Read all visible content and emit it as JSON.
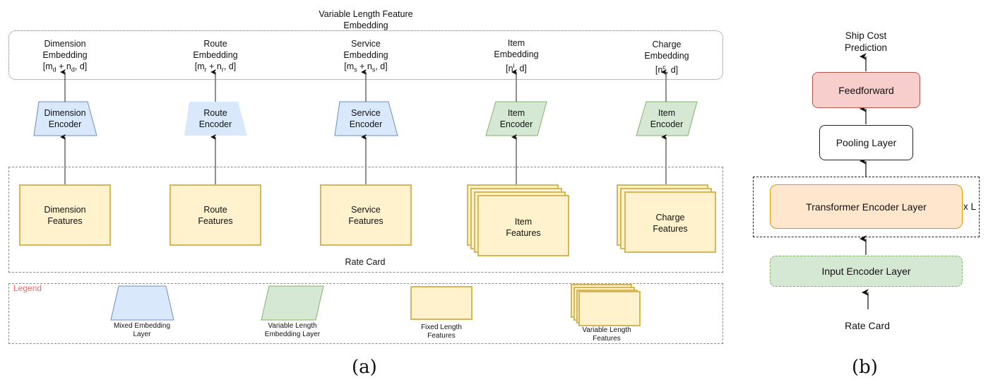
{
  "panel_a": {
    "caption": "(a)",
    "embedding_group": {
      "title_line1": "Variable Length Feature",
      "title_line2": "Embedding"
    },
    "columns": [
      {
        "id": "dimension",
        "embedding": {
          "line1": "Dimension",
          "line2": "Embedding",
          "shape_base": "[m",
          "shape_sub1": "d",
          "shape_mid": " + n",
          "shape_sub2": "d",
          "shape_tail": ", d]"
        },
        "encoder": {
          "line1": "Dimension",
          "line2": "Encoder",
          "type": "mixed-embedding"
        },
        "features": {
          "line1": "Dimension",
          "line2": "Features",
          "type": "fixed-length"
        }
      },
      {
        "id": "route",
        "embedding": {
          "line1": "Route",
          "line2": "Embedding",
          "shape_base": "[m",
          "shape_sub1": "r",
          "shape_mid": " + n",
          "shape_sub2": "r",
          "shape_tail": ", d]"
        },
        "encoder": {
          "line1": "Route",
          "line2": "Encoder",
          "type": "mixed-embedding"
        },
        "features": {
          "line1": "Route",
          "line2": "Features",
          "type": "fixed-length"
        }
      },
      {
        "id": "service",
        "embedding": {
          "line1": "Service",
          "line2": "Embedding",
          "shape_base": "[m",
          "shape_sub1": "s",
          "shape_mid": " + n",
          "shape_sub2": "s",
          "shape_tail": ", d]"
        },
        "encoder": {
          "line1": "Service",
          "line2": "Encoder",
          "type": "mixed-embedding"
        },
        "features": {
          "line1": "Service",
          "line2": "Features",
          "type": "fixed-length"
        }
      },
      {
        "id": "item",
        "embedding": {
          "line1": "Item",
          "line2": "Embedding",
          "shape_base": "[n",
          "shape_sup": "i",
          "shape_tail": ", d]"
        },
        "encoder": {
          "line1": "Item",
          "line2": "Encoder",
          "type": "variable-length-embedding"
        },
        "features": {
          "line1": "Item",
          "line2": "Features",
          "type": "variable-length"
        }
      },
      {
        "id": "charge",
        "embedding": {
          "line1": "Charge",
          "line2": "Embedding",
          "shape_base": "[n",
          "shape_sup": "c",
          "shape_tail": ", d]"
        },
        "encoder": {
          "line1": "Item",
          "line2": "Encoder",
          "type": "variable-length-embedding"
        },
        "features": {
          "line1": "Charge",
          "line2": "Features",
          "type": "variable-length"
        }
      }
    ],
    "rate_card_label": "Rate Card",
    "legend": {
      "title": "Legend",
      "title_color": "#ea6b66",
      "items": [
        {
          "line1": "Mixed Embedding",
          "line2": "Layer",
          "shape": "trapezoid"
        },
        {
          "line1": "Variable Length",
          "line2": "Embedding Layer",
          "shape": "parallelogram"
        },
        {
          "line1": "Fixed Length",
          "line2": "Features",
          "shape": "rectangle"
        },
        {
          "line1": "Variable Length",
          "line2": "Features",
          "shape": "stacked-rectangles"
        }
      ]
    }
  },
  "panel_b": {
    "caption": "(b)",
    "output_line1": "Ship Cost",
    "output_line2": "Prediction",
    "feedforward": "Feedforward",
    "pooling": "Pooling Layer",
    "transformer": "Transformer Encoder Layer",
    "repeat": "x L",
    "input_encoder": "Input Encoder Layer",
    "input": "Rate Card"
  },
  "colors": {
    "mixed_fill": "#dae8fc",
    "mixed_stroke": "#6c8ebf",
    "varlen_fill": "#d5e8d4",
    "varlen_stroke": "#82b366",
    "feature_fill": "#fff2cc",
    "feature_stroke": "#d6b656",
    "feedforward_fill": "#f8cecc",
    "feedforward_stroke": "#b85450",
    "transformer_fill": "#ffe6cc",
    "transformer_stroke": "#d79b00"
  }
}
